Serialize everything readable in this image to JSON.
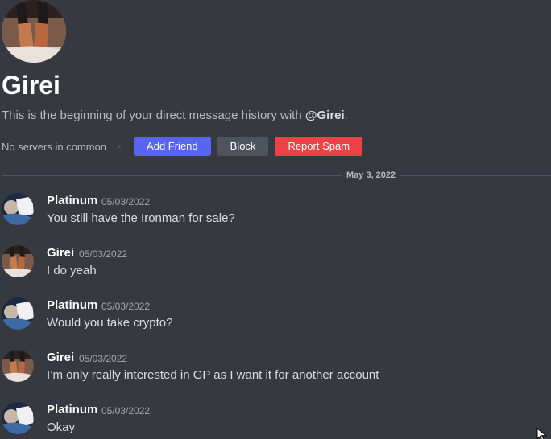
{
  "profile": {
    "name": "Girei",
    "intro_text": "This is the beginning of your direct message history with ",
    "intro_mention": "@Girei",
    "intro_end": "."
  },
  "actions": {
    "no_servers": "No servers in common",
    "add_friend": "Add Friend",
    "block": "Block",
    "report_spam": "Report Spam"
  },
  "divider": {
    "date": "May 3, 2022"
  },
  "messages": [
    {
      "user": "Platinum",
      "avatar": "platinum-avatar",
      "time": "05/03/2022",
      "text": "You still have the Ironman for sale?"
    },
    {
      "user": "Girei",
      "avatar": "girei-avatar",
      "time": "05/03/2022",
      "text": "I do yeah"
    },
    {
      "user": "Platinum",
      "avatar": "platinum-avatar",
      "time": "05/03/2022",
      "text": "Would you take crypto?"
    },
    {
      "user": "Girei",
      "avatar": "girei-avatar",
      "time": "05/03/2022",
      "text": "I’m only really interested in GP as I want it for another account"
    },
    {
      "user": "Platinum",
      "avatar": "platinum-avatar",
      "time": "05/03/2022",
      "text": "Okay"
    }
  ],
  "colors": {
    "background": "#36393f",
    "primary_button": "#5865f2",
    "secondary_button": "#4f545c",
    "danger_button": "#ed4245"
  },
  "icons": {
    "cursor": "mouse-pointer-icon"
  }
}
